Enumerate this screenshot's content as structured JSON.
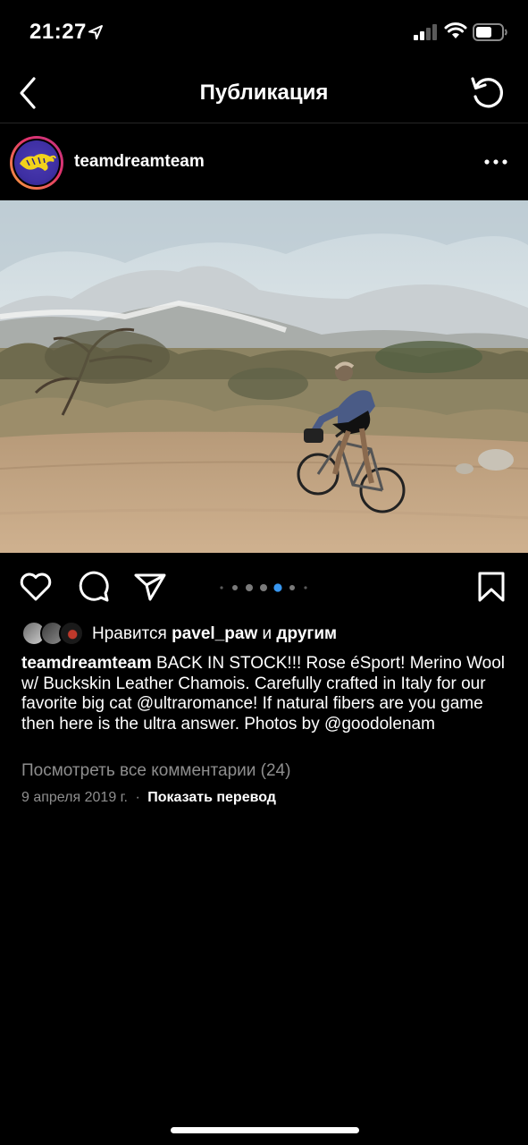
{
  "status_bar": {
    "time": "21:27"
  },
  "nav": {
    "title": "Публикация"
  },
  "post": {
    "username": "teamdreamteam",
    "image_count": 7,
    "active_image_index": 4
  },
  "likes": {
    "prefix": "Нравится",
    "user": "pavel_paw",
    "conjunction": "и",
    "others": "другим"
  },
  "caption": {
    "author": "teamdreamteam",
    "text": "BACK IN STOCK!!! Rose éSport! Merino Wool w/ Buckskin Leather Chamois. Carefully crafted in Italy for our favorite big cat @ultraromance! If natural fibers are you game then here is the ultra answer. Photos by @goodolenam"
  },
  "view_comments": "Посмотреть все комментарии (24)",
  "date": "9 апреля 2019 г.",
  "separator": "·",
  "translate": "Показать перевод",
  "colors": {
    "background": "#000000",
    "secondary_text": "#8e8e8e",
    "active_dot": "#3897f0"
  }
}
